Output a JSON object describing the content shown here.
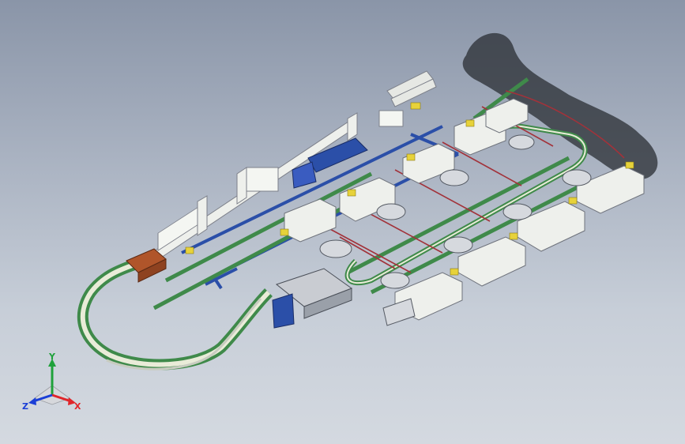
{
  "viewport": {
    "background_top": "#8a95a8",
    "background_bottom": "#d4d9e0"
  },
  "model": {
    "colors": {
      "conveyor_green": "#3f8a4a",
      "conveyor_light": "#e9ecd8",
      "frame_blue": "#2b4fa8",
      "cable_red": "#a2323a",
      "machine_white": "#eef0ec",
      "accent_yellow": "#e7d23a",
      "hopper_brown": "#b0552a",
      "ducting_gray": "#7d808a"
    }
  },
  "triad": {
    "x_label": "X",
    "y_label": "Y",
    "z_label": "Z",
    "x_color": "#e0262b",
    "y_color": "#1fa13b",
    "z_color": "#1b3fd6"
  }
}
